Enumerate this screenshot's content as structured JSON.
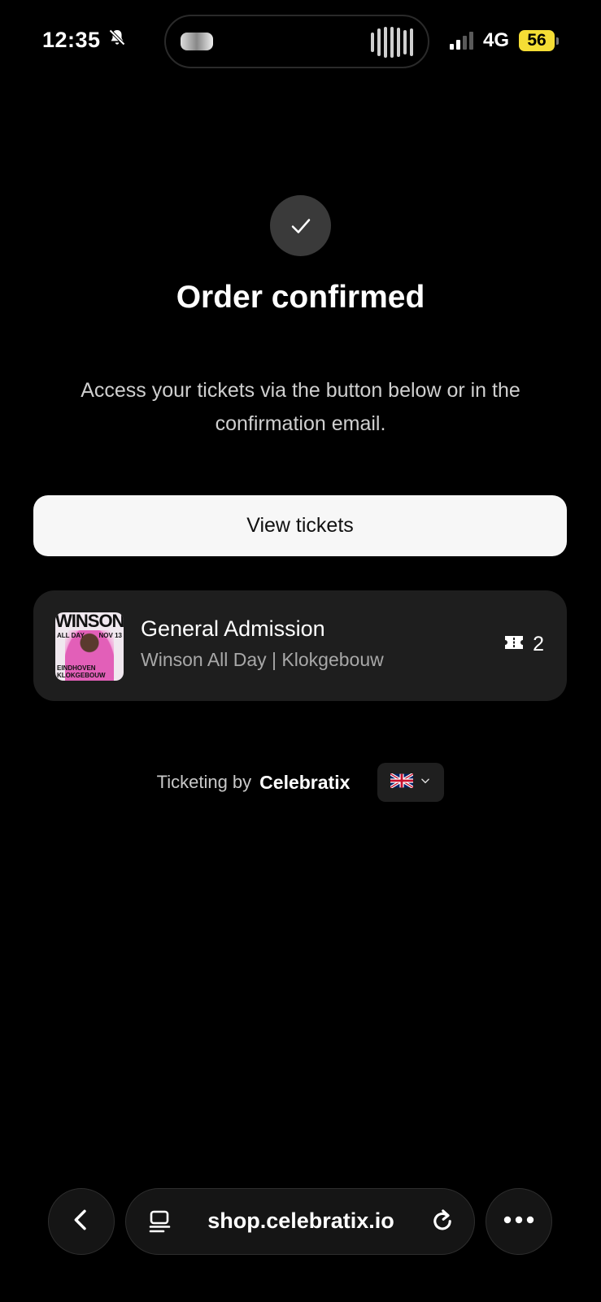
{
  "status_bar": {
    "time": "12:35",
    "network": "4G",
    "battery": "56"
  },
  "main": {
    "title": "Order confirmed",
    "subtitle": "Access your tickets via the button below or in the confirmation email.",
    "view_button_label": "View tickets"
  },
  "ticket": {
    "name": "General Admission",
    "event": "Winson All Day | Klokgebouw",
    "quantity": "2",
    "thumb_title": "WINSON",
    "thumb_tag_left": "ALL DAY",
    "thumb_tag_right": "NOV 13",
    "thumb_tag_bottom": "EINDHOVEN KLOKGEBOUW"
  },
  "footer": {
    "ticketing_by": "Ticketing by",
    "brand": "Celebratix",
    "language_icon": "uk-flag-icon"
  },
  "browser": {
    "url": "shop.celebratix.io"
  },
  "colors": {
    "background": "#000000",
    "card": "#1e1e1e",
    "button": "#f7f7f7",
    "battery": "#f5dd35"
  }
}
